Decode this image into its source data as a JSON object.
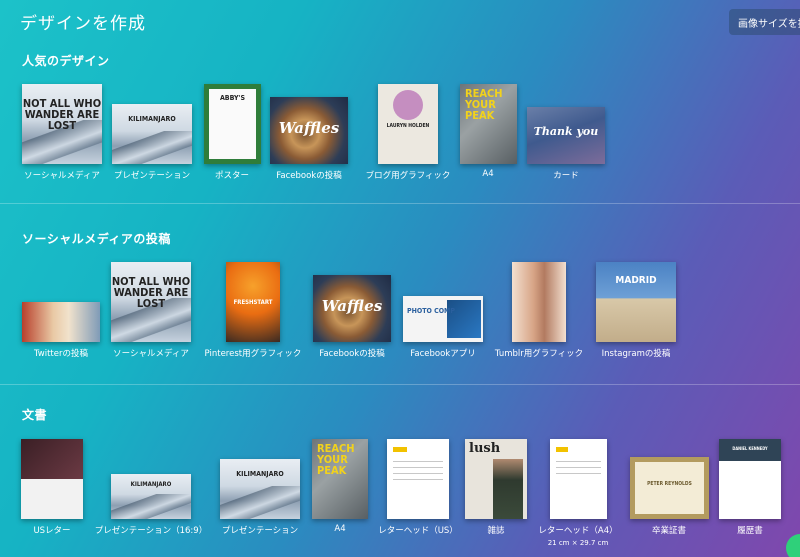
{
  "header": {
    "title": "デザインを作成",
    "resize_button": "画像サイズを指定"
  },
  "sections": [
    {
      "title": "人気のデザイン",
      "items": [
        {
          "label": "ソーシャルメディア",
          "thumb_text": "NOT ALL WHO WANDER ARE LOST"
        },
        {
          "label": "プレゼンテーション",
          "thumb_text": "KILIMANJARO"
        },
        {
          "label": "ポスター",
          "thumb_text": "ABBY'S"
        },
        {
          "label": "Facebookの投稿",
          "thumb_text": "Waffles"
        },
        {
          "label": "ブログ用グラフィック",
          "thumb_text": "LAURYN HOLDEN"
        },
        {
          "label": "A4",
          "thumb_text": "REACH YOUR PEAK"
        },
        {
          "label": "カード",
          "thumb_text": "Thank you"
        }
      ]
    },
    {
      "title": "ソーシャルメディアの投稿",
      "items": [
        {
          "label": "Twitterの投稿"
        },
        {
          "label": "ソーシャルメディア",
          "thumb_text": "NOT ALL WHO WANDER ARE LOST"
        },
        {
          "label": "Pinterest用グラフィック",
          "thumb_text": "FRESHSTART"
        },
        {
          "label": "Facebookの投稿",
          "thumb_text": "Waffles"
        },
        {
          "label": "Facebookアプリ",
          "thumb_text": "PHOTO COMP"
        },
        {
          "label": "Tumblr用グラフィック"
        },
        {
          "label": "Instagramの投稿",
          "thumb_text": "MADRID"
        }
      ]
    },
    {
      "title": "文書",
      "items": [
        {
          "label": "USレター"
        },
        {
          "label": "プレゼンテーション（16:9）",
          "thumb_text": "KILIMANJARO"
        },
        {
          "label": "プレゼンテーション",
          "thumb_text": "KILIMANJARO"
        },
        {
          "label": "A4",
          "thumb_text": "REACH YOUR PEAK"
        },
        {
          "label": "レターヘッド（US）"
        },
        {
          "label": "雑誌",
          "thumb_text": "lush"
        },
        {
          "label": "レターヘッド（A4）",
          "sublabel": "21 cm × 29.7 cm"
        },
        {
          "label": "卒業証書",
          "thumb_text": "PETER REYNOLDS"
        },
        {
          "label": "履歴書",
          "thumb_text": "DANIEL KENNEDY"
        }
      ]
    }
  ]
}
